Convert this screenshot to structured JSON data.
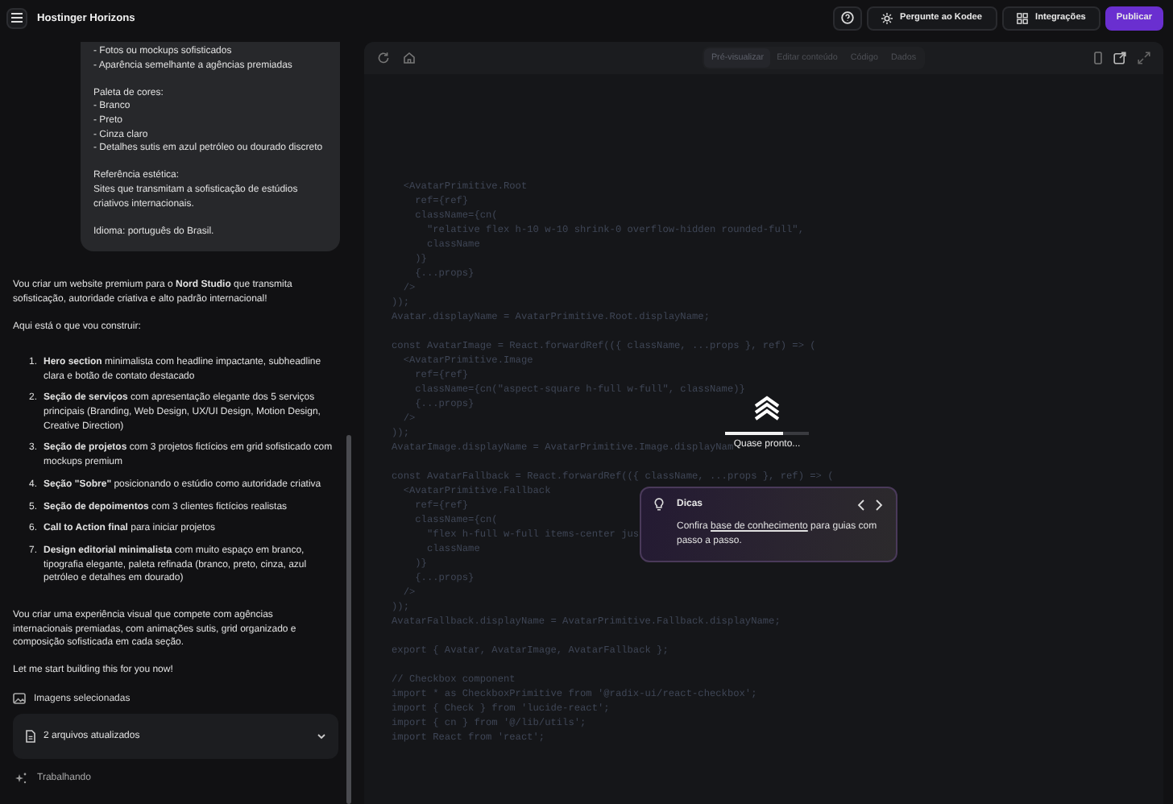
{
  "app": {
    "title": "Hostinger Horizons"
  },
  "header_buttons": [
    {
      "kind": "help"
    },
    {
      "kind": "assistant",
      "label": "Pergunte ao Kodee"
    },
    {
      "kind": "integrations",
      "label": "Integrações"
    },
    {
      "kind": "primary",
      "label": "Publicar"
    }
  ],
  "chat": {
    "user_message": [
      "- Fotos ou mockups sofisticados\n- Aparência semelhante a agências premiadas",
      "Paleta de cores:\n- Branco\n- Preto\n- Cinza claro\n- Detalhes sutis em azul petróleo ou dourado discreto",
      "Referência estética:\nSites que transmitam a sofisticação de estúdios criativos internacionais.",
      "Idioma: português do Brasil."
    ],
    "intro": [
      "Vou criar um website premium para o **Nord Studio** que transmita sofisticação, autoridade criativa e alto padrão internacional!",
      "Aqui está o que vou construir:"
    ],
    "plan": [
      {
        "number": "1.",
        "text": "**Hero section** minimalista com headline impactante, subheadline clara e botão de contato destacado"
      },
      {
        "number": "2.",
        "text": "**Seção de serviços** com apresentação elegante dos 5 serviços principais (Branding, Web Design, UX/UI Design, Motion Design, Creative Direction)"
      },
      {
        "number": "3.",
        "text": "**Seção de projetos** com 3 projetos fictícios em grid sofisticado com mockups premium"
      },
      {
        "number": "4.",
        "text": "**Seção \"Sobre\"** posicionando o estúdio como autoridade criativa"
      },
      {
        "number": "5.",
        "text": "**Seção de depoimentos** com 3 clientes fictícios realistas"
      },
      {
        "number": "6.",
        "text": "**Call to Action final** para iniciar projetos"
      },
      {
        "number": "7.",
        "text": "**Design editorial minimalista** com muito espaço em branco, tipografia elegante, paleta refinada (branco, preto, cinza, azul petróleo e detalhes em dourado)"
      }
    ],
    "outro": [
      "Vou criar uma experiência visual que compete com agências internacionais premiadas, com animações sutis, grid organizado e composição sofisticada em cada seção.",
      "Let me start building this for you now!"
    ],
    "images_label": "Imagens selecionadas",
    "files": {
      "label": "2 arquivos atualizados",
      "expanded": false
    },
    "status": "Trabalhando"
  },
  "preview": {
    "tabs": [
      {
        "label": "Pré-visualizar",
        "selected": true
      },
      {
        "label": "Editar conteúdo",
        "selected": false
      },
      {
        "label": "Código",
        "selected": false
      },
      {
        "label": "Dados",
        "selected": false
      }
    ],
    "code_blocks": [
      [
        "  <AvatarPrimitive.Root",
        "    ref={ref}",
        "    className={cn(",
        "      \"relative flex h-10 w-10 shrink-0 overflow-hidden rounded-full\",",
        "      className",
        "    )}",
        "    {...props}",
        "  />",
        "));",
        "Avatar.displayName = AvatarPrimitive.Root.displayName;"
      ],
      [
        "const AvatarImage = React.forwardRef(({ className, ...props }, ref) => (",
        "  <AvatarPrimitive.Image",
        "    ref={ref}",
        "    className={cn(\"aspect-square h-full w-full\", className)}",
        "    {...props}",
        "  />",
        "));",
        "AvatarImage.displayName = AvatarPrimitive.Image.displayNam"
      ],
      [
        "const AvatarFallback = React.forwardRef(({ className, ...props }, ref) => (",
        "  <AvatarPrimitive.Fallback",
        "    ref={ref}",
        "    className={cn(",
        "      \"flex h-full w-full items-center jus",
        "      className",
        "    )}",
        "    {...props}",
        "  />",
        "));",
        "AvatarFallback.displayName = AvatarPrimitive.Fallback.displayName;"
      ],
      [
        "export { Avatar, AvatarImage, AvatarFallback };"
      ],
      [
        "// Checkbox component",
        "import * as CheckboxPrimitive from '@radix-ui/react-checkbox';",
        "import { Check } from 'lucide-react';",
        "import { cn } from '@/lib/utils';",
        "import React from 'react';"
      ]
    ],
    "loader": {
      "label": "Quase pronto...",
      "level": 0.7
    },
    "tips": {
      "title": "Dicas",
      "text_before": "Confira",
      "link": "base de conhecimento",
      "text_after": "para guias com passo a passo."
    }
  }
}
